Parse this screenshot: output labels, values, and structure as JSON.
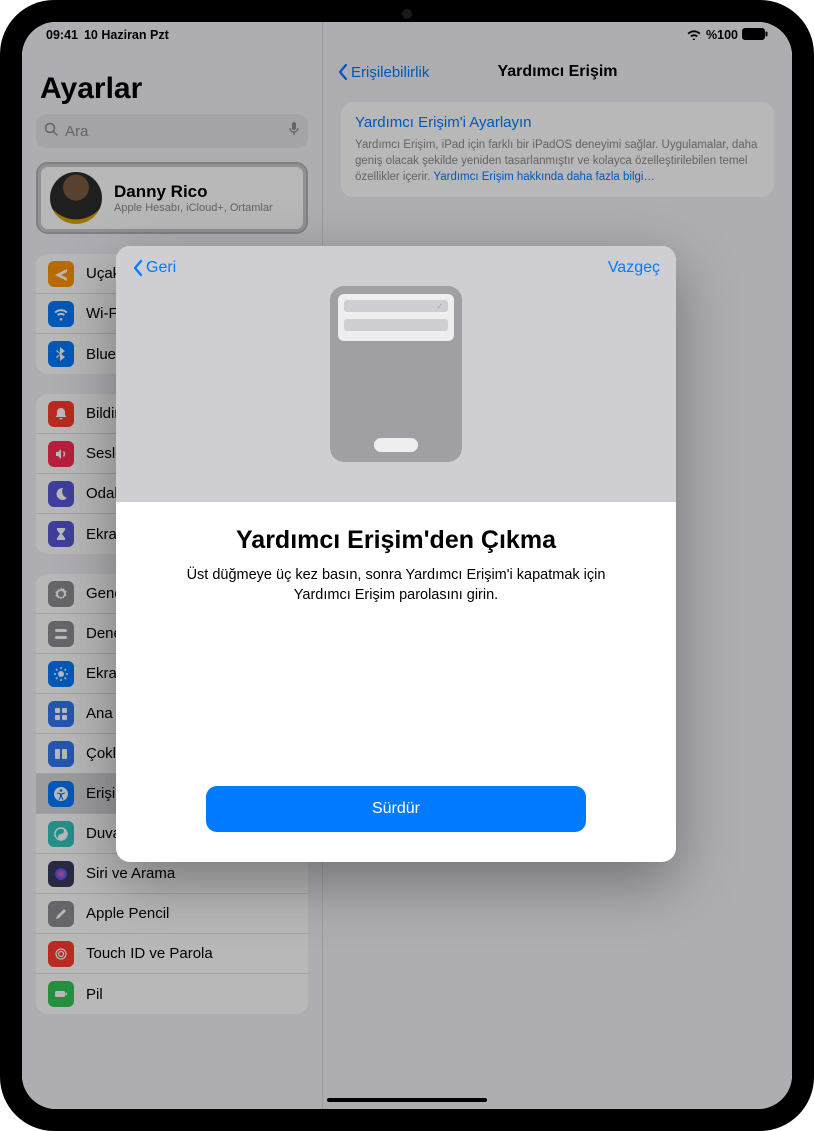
{
  "status": {
    "time": "09:41",
    "date": "10 Haziran Pzt",
    "battery_pct": "%100"
  },
  "sidebar": {
    "title": "Ayarlar",
    "search_placeholder": "Ara",
    "profile": {
      "name": "Danny Rico",
      "sub": "Apple Hesabı, iCloud+, Ortamlar"
    },
    "group1": [
      {
        "label": "Uçak Modu",
        "color": "#ff9500",
        "icon": "airplane"
      },
      {
        "label": "Wi-Fi",
        "color": "#007aff",
        "icon": "wifi"
      },
      {
        "label": "Bluetooth",
        "color": "#007aff",
        "icon": "bluetooth"
      }
    ],
    "group2": [
      {
        "label": "Bildirimler",
        "color": "#ff3b30",
        "icon": "bell"
      },
      {
        "label": "Sesler",
        "color": "#ff2d55",
        "icon": "speaker"
      },
      {
        "label": "Odak",
        "color": "#5856d6",
        "icon": "moon"
      },
      {
        "label": "Ekran Süresi",
        "color": "#5856d6",
        "icon": "hourglass"
      }
    ],
    "group3": [
      {
        "label": "Genel",
        "color": "#8e8e93",
        "icon": "gear"
      },
      {
        "label": "Denetim Merkezi",
        "color": "#8e8e93",
        "icon": "switches"
      },
      {
        "label": "Ekran ve Parlaklık",
        "color": "#007aff",
        "icon": "brightness"
      },
      {
        "label": "Ana Ekran ve Uygulama Arşivi",
        "color": "#3478f6",
        "icon": "grid"
      },
      {
        "label": "Çoklu Görev ve Hareketler",
        "color": "#3478f6",
        "icon": "multitask"
      },
      {
        "label": "Erişilebilirlik",
        "color": "#007aff",
        "icon": "accessibility",
        "selected": true
      },
      {
        "label": "Duvar Kâğıdı",
        "color": "#34c7c0",
        "icon": "wallpaper"
      },
      {
        "label": "Siri ve Arama",
        "color": "#3a3a5a",
        "icon": "siri"
      },
      {
        "label": "Apple Pencil",
        "color": "#8e8e93",
        "icon": "pencil"
      },
      {
        "label": "Touch ID ve Parola",
        "color": "#ff3b30",
        "icon": "touchid"
      },
      {
        "label": "Pil",
        "color": "#34c759",
        "icon": "battery"
      }
    ]
  },
  "detail": {
    "back": "Erişilebilirlik",
    "title": "Yardımcı Erişim",
    "card_title": "Yardımcı Erişim'i Ayarlayın",
    "card_desc": "Yardımcı Erişim, iPad için farklı bir iPadOS deneyimi sağlar. Uygulamalar, daha geniş olacak şekilde yeniden tasarlanmıştır ve kolayca özelleştirilebilen temel özellikler içerir. ",
    "card_link": "Yardımcı Erişim hakkında daha fazla bilgi…"
  },
  "modal": {
    "back": "Geri",
    "cancel": "Vazgeç",
    "title": "Yardımcı Erişim'den Çıkma",
    "desc": "Üst düğmeye üç kez basın, sonra Yardımcı Erişim'i kapatmak için Yardımcı Erişim parolasını girin.",
    "continue": "Sürdür"
  }
}
